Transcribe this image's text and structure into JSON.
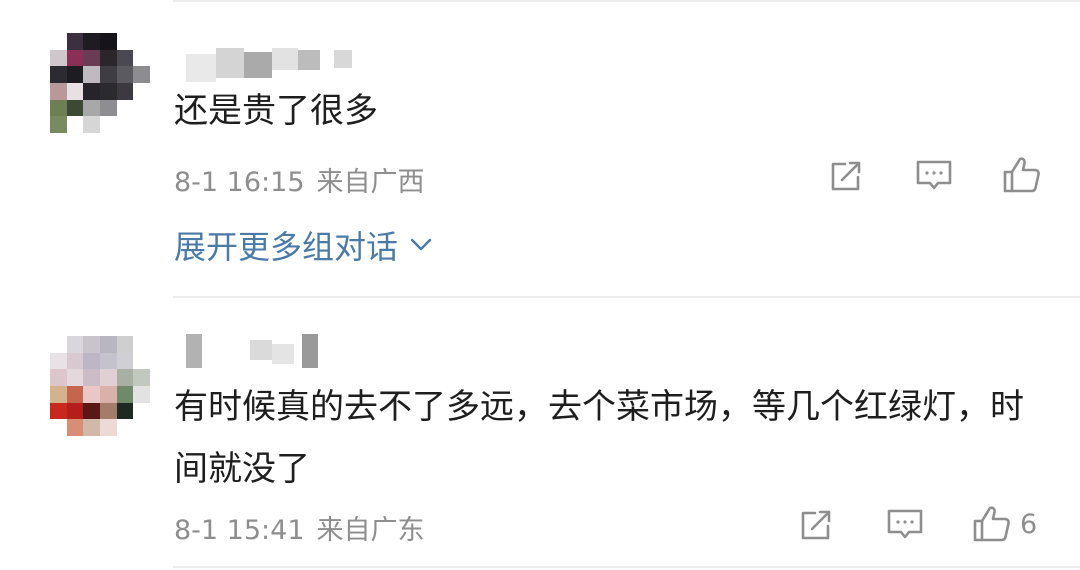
{
  "comments": [
    {
      "text": "还是贵了很多",
      "time": "8-1 16:15",
      "source": "来自广西",
      "likes": "",
      "expand_label": "展开更多组对话"
    },
    {
      "text": "有时候真的去不了多远，去个菜市场，等几个红绿灯，时间就没了",
      "time": "8-1 15:41",
      "source": "来自广东",
      "likes": "6"
    }
  ],
  "icons": [
    "share-icon",
    "comment-icon",
    "like-icon",
    "chevron-down-icon"
  ],
  "colors": {
    "link": "#4a7aa8",
    "meta": "#8e8e8e",
    "divider": "#ececec",
    "icon": "#8e8e8e"
  }
}
